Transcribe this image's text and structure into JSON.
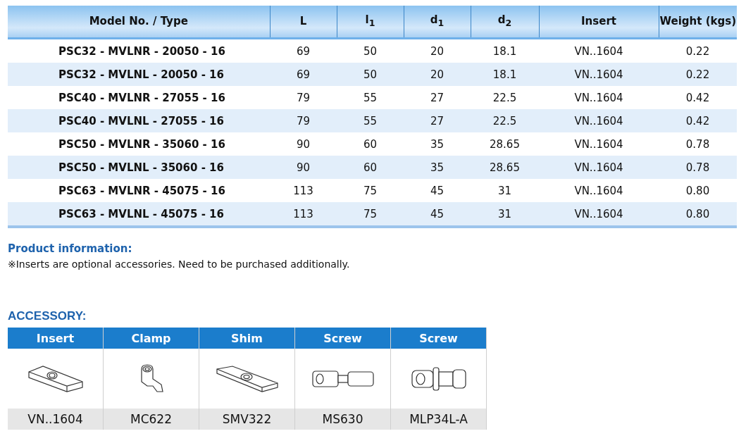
{
  "spec_table": {
    "columns": [
      "Model No. / Type",
      "L",
      "l$_{1}$",
      "d$_{1}$",
      "d$_{2}$",
      "Insert",
      "Weight (kgs)"
    ],
    "rows": [
      [
        "PSC32 - MVLNR - 20050 - 16",
        "69",
        "50",
        "20",
        "18.1",
        "VN..1604",
        "0.22"
      ],
      [
        "PSC32 - MVLNL - 20050 - 16",
        "69",
        "50",
        "20",
        "18.1",
        "VN..1604",
        "0.22"
      ],
      [
        "PSC40 - MVLNR - 27055 - 16",
        "79",
        "55",
        "27",
        "22.5",
        "VN..1604",
        "0.42"
      ],
      [
        "PSC40 - MVLNL - 27055 - 16",
        "79",
        "55",
        "27",
        "22.5",
        "VN..1604",
        "0.42"
      ],
      [
        "PSC50 - MVLNR - 35060 - 16",
        "90",
        "60",
        "35",
        "28.65",
        "VN..1604",
        "0.78"
      ],
      [
        "PSC50 - MVLNL - 35060 - 16",
        "90",
        "60",
        "35",
        "28.65",
        "VN..1604",
        "0.78"
      ],
      [
        "PSC63 - MVLNR - 45075 - 16",
        "113",
        "75",
        "45",
        "31",
        "VN..1604",
        "0.80"
      ],
      [
        "PSC63 - MVLNL - 45075 - 16",
        "113",
        "75",
        "45",
        "31",
        "VN..1604",
        "0.80"
      ]
    ]
  },
  "product_information": {
    "heading": "Product information:",
    "note": "※Inserts are optional accessories. Need to be purchased additionally."
  },
  "accessory": {
    "heading": "ACCESSORY:",
    "items": [
      {
        "kind": "insert",
        "label": "Insert",
        "code": "VN..1604"
      },
      {
        "kind": "clamp",
        "label": "Clamp",
        "code": "MC622"
      },
      {
        "kind": "shim",
        "label": "Shim",
        "code": "SMV322"
      },
      {
        "kind": "screw",
        "label": "Screw",
        "code": "MS630"
      },
      {
        "kind": "pin",
        "label": "Screw",
        "code": "MLP34L-A"
      }
    ]
  }
}
